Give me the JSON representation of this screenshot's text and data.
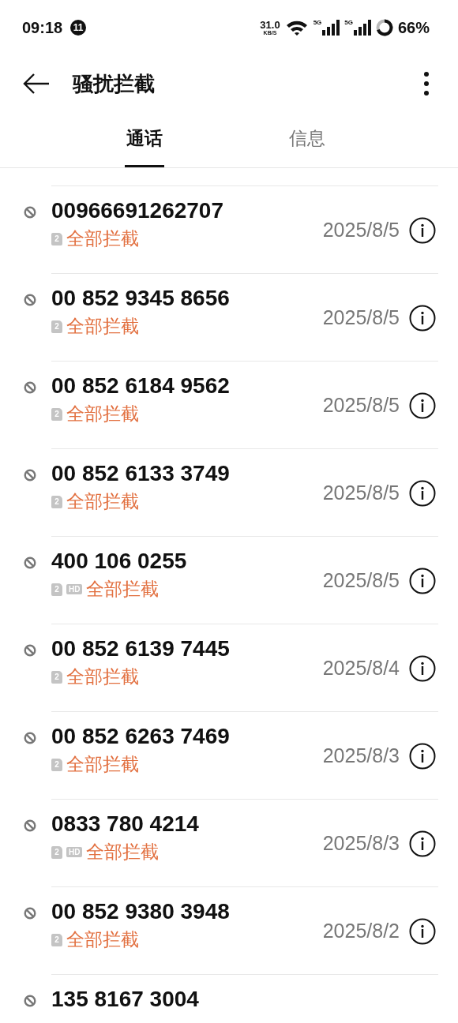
{
  "status_bar": {
    "time": "09:18",
    "notification_count": "11",
    "speed": "31.0",
    "speed_unit": "KB/S",
    "sim_1_network": "5G",
    "sim_2_network": "5G",
    "battery": "66%"
  },
  "header": {
    "title": "骚扰拦截"
  },
  "tabs": [
    {
      "label": "通话",
      "selected": true
    },
    {
      "label": "信息",
      "selected": false
    }
  ],
  "calls": [
    {
      "number": "00966691262707",
      "sim": "2",
      "status": "全部拦截",
      "date": "2025/8/5"
    },
    {
      "number": "00 852 9345 8656",
      "sim": "2",
      "status": "全部拦截",
      "date": "2025/8/5"
    },
    {
      "number": "00 852 6184 9562",
      "sim": "2",
      "status": "全部拦截",
      "date": "2025/8/5"
    },
    {
      "number": "00 852 6133 3749",
      "sim": "2",
      "status": "全部拦截",
      "date": "2025/8/5"
    },
    {
      "number": "400 106 0255",
      "sim": "2",
      "hd_label": "HD",
      "status": "全部拦截",
      "date": "2025/8/5"
    },
    {
      "number": "00 852 6139 7445",
      "sim": "2",
      "status": "全部拦截",
      "date": "2025/8/4"
    },
    {
      "number": "00 852 6263 7469",
      "sim": "2",
      "status": "全部拦截",
      "date": "2025/8/3"
    },
    {
      "number": "0833 780 4214",
      "sim": "2",
      "hd_label": "HD",
      "status": "全部拦截",
      "date": "2025/8/3"
    },
    {
      "number": "00 852 9380 3948",
      "sim": "2",
      "status": "全部拦截",
      "date": "2025/8/2"
    },
    {
      "number": "135 8167 3004"
    }
  ]
}
